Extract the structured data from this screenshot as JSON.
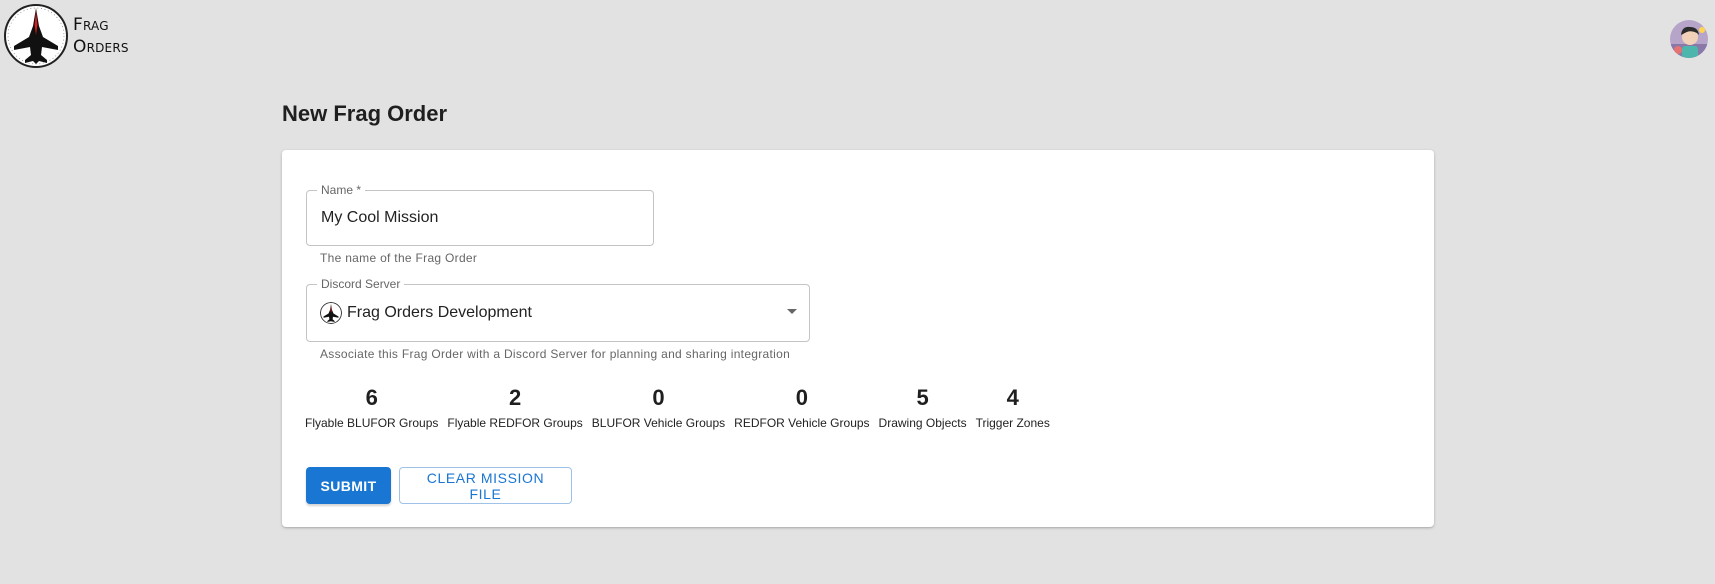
{
  "brand": {
    "line1": "Frag",
    "line2": "Orders"
  },
  "page": {
    "title": "New Frag Order"
  },
  "form": {
    "name": {
      "label": "Name *",
      "value": "My Cool Mission",
      "helper": "The name of the Frag Order"
    },
    "server": {
      "label": "Discord Server",
      "value": "Frag Orders Development",
      "helper": "Associate this Frag Order with a Discord Server for planning and sharing integration"
    }
  },
  "stats": [
    {
      "value": "6",
      "label": "Flyable BLUFOR Groups"
    },
    {
      "value": "2",
      "label": "Flyable REDFOR Groups"
    },
    {
      "value": "0",
      "label": "BLUFOR Vehicle Groups"
    },
    {
      "value": "0",
      "label": "REDFOR Vehicle Groups"
    },
    {
      "value": "5",
      "label": "Drawing Objects"
    },
    {
      "value": "4",
      "label": "Trigger Zones"
    }
  ],
  "actions": {
    "submit_label": "SUBMIT",
    "clear_label": "CLEAR MISSION FILE"
  },
  "icons": {
    "logo": "fighter-jet-logo-icon",
    "avatar": "user-avatar",
    "server": "discord-server-icon",
    "dropdown": "chevron-down-icon"
  },
  "colors": {
    "primary": "#1976d2",
    "background": "#e2e2e2",
    "card": "#ffffff",
    "logo_accent": "#d81b1b"
  }
}
